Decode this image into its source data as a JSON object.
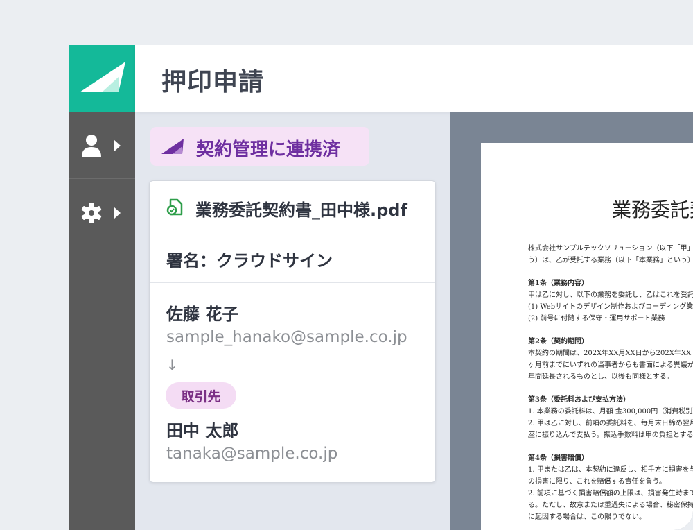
{
  "header": {
    "title": "押印申請"
  },
  "sidebar": {
    "items": [
      {
        "name": "user-menu",
        "icon": "user-icon"
      },
      {
        "name": "settings-menu",
        "icon": "gear-icon"
      }
    ]
  },
  "badge": {
    "icon": "contract-logo-icon",
    "label": "契約管理に連携済"
  },
  "card": {
    "file_name": "業務委託契約書_田中様.pdf",
    "sign_method": "署名：クラウドサイン",
    "sender": {
      "name": "佐藤 花子",
      "email": "sample_hanako@sample.co.jp"
    },
    "arrow": "↓",
    "tag": "取引先",
    "recipient": {
      "name": "田中 太郎",
      "email": "tanaka@sample.co.jp"
    }
  },
  "document": {
    "title": "業務委託契",
    "lines": [
      "株式会社サンプルテックソリューション（以下「甲」",
      "う）は、乙が受託する業務（以下「本業務」という）",
      "第1条（業務内容）",
      "甲は乙に対し、以下の業務を委託し、乙はこれを受託",
      "(1) Webサイトのデザイン制作およびコーディング業務",
      "(2) 前号に付随する保守・運用サポート業務",
      "第2条（契約期間）",
      "本契約の期間は、202X年XX月XX日から202X年XX",
      "ヶ月前までにいずれの当事者からも書面による異議が",
      "年間延長されるものとし、以後も同様とする。",
      "第3条（委託料および支払方法）",
      "1. 本業務の委託料は、月額 金300,000円（消費税別）",
      "2. 甲は乙に対し、前項の委託料を、毎月末日締め翌月",
      "座に振り込んで支払う。振込手数料は甲の負担とする。",
      "第4条（損害賠償）",
      "1. 甲または乙は、本契約に違反し、相手方に損害を与",
      "の損害に限り、これを賠償する責任を負う。",
      "2. 前項に基づく損害賠償額の上限は、損害発生時まで",
      "る。ただし、故意または重過失による場合、秘密保持",
      "に起因する場合は、この限りでない。"
    ]
  },
  "colors": {
    "brand": "#14b999",
    "accent_purple": "#6e2fa0",
    "badge_bg": "#f6e2f6",
    "rail": "#5a5a5a",
    "success_green": "#2e9e4a"
  }
}
